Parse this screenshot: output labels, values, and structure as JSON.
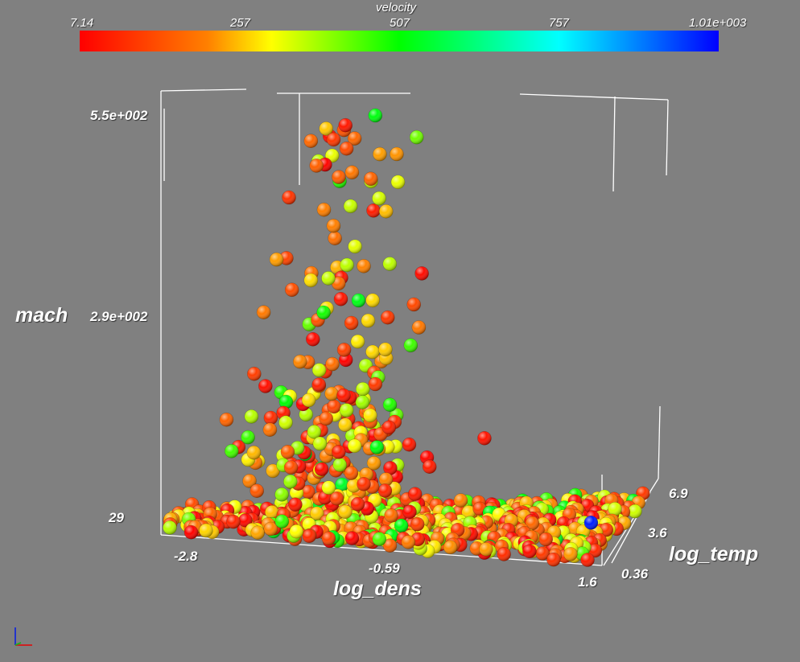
{
  "chart_data": {
    "type": "scatter",
    "variant": "3d-point-glyphs",
    "background": "#808080",
    "axes": {
      "x": {
        "label": "log_dens",
        "ticks": [
          "-2.8",
          "-0.59",
          "1.6"
        ],
        "range": [
          -2.8,
          1.6
        ]
      },
      "y": {
        "label": "mach",
        "ticks": [
          "29",
          "2.9e+002",
          "5.5e+002"
        ],
        "range": [
          29,
          550
        ]
      },
      "z": {
        "label": "log_temp",
        "ticks": [
          "0.36",
          "3.6",
          "6.9"
        ],
        "range": [
          0.36,
          6.9
        ]
      }
    },
    "color_legend": {
      "title": "velocity",
      "ticks": [
        "7.14",
        "257",
        "507",
        "757",
        "1.01e+003"
      ],
      "range": [
        7.14,
        1010
      ],
      "colormap": [
        "#ff0000",
        "#ff8000",
        "#ffff00",
        "#00ff00",
        "#00ffff",
        "#0000ff"
      ]
    },
    "approx_point_count": 900,
    "note_points": "Dense point cloud concentrated at low mach near the density/temperature floor, with a sparse plume rising to mach ~550 near log_dens -1; colors mostly red/orange/yellow with some green and one blue point."
  }
}
